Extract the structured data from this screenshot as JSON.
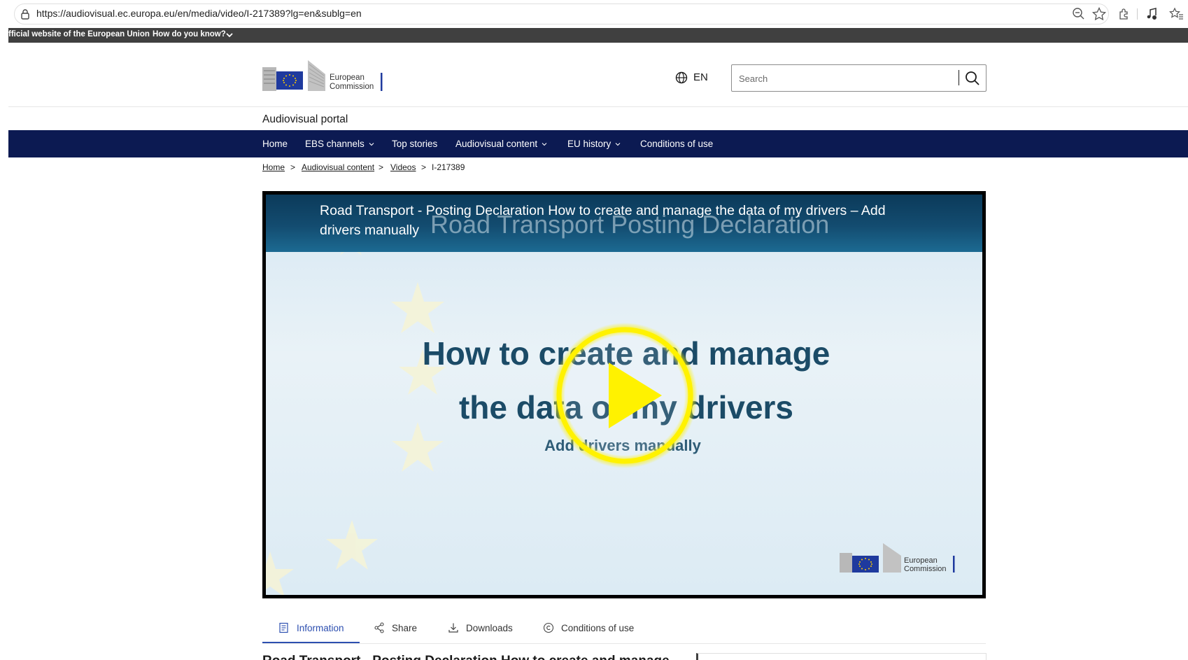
{
  "browser": {
    "url": "https://audiovisual.ec.europa.eu/en/media/video/I-217389?lg=en&sublg=en",
    "icons": [
      "lock-icon",
      "zoom-out-icon",
      "star-icon",
      "extensions-icon",
      "media-control-icon",
      "favorites-icon"
    ]
  },
  "gov_banner": {
    "text": "fficial website of the European Union",
    "link": "How do you know?"
  },
  "header": {
    "logo_line1": "European",
    "logo_line2": "Commission",
    "language": "EN",
    "search_placeholder": "Search",
    "portal_name": "Audiovisual portal"
  },
  "nav": {
    "items": [
      {
        "label": "Home",
        "dropdown": false
      },
      {
        "label": "EBS channels",
        "dropdown": true
      },
      {
        "label": "Top stories",
        "dropdown": false
      },
      {
        "label": "Audiovisual content",
        "dropdown": true
      },
      {
        "label": "EU history",
        "dropdown": true
      },
      {
        "label": "Conditions of use",
        "dropdown": false
      }
    ]
  },
  "breadcrumb": {
    "items": [
      "Home",
      "Audiovisual content",
      "Videos",
      "I-217389"
    ],
    "separator": ">"
  },
  "video": {
    "title": "Road Transport - Posting Declaration How to create and manage the data of my drivers – Add drivers manually",
    "slide_banner": "Road Transport Posting Declaration",
    "slide_line1": "How to create and manage",
    "slide_line2": "the data of my drivers",
    "slide_sub": "Add drivers manually",
    "logo_line1": "European",
    "logo_line2": "Commission",
    "play_color": "#fff200"
  },
  "tabs": {
    "items": [
      {
        "label": "Information",
        "icon": "information-icon",
        "active": true
      },
      {
        "label": "Share",
        "icon": "share-icon",
        "active": false
      },
      {
        "label": "Downloads",
        "icon": "download-icon",
        "active": false
      },
      {
        "label": "Conditions of use",
        "icon": "copyright-icon",
        "active": false
      }
    ]
  },
  "content": {
    "heading": "Road Transport - Posting Declaration How to create and manage"
  },
  "colors": {
    "nav_bg": "#0c1a52",
    "gov_banner_bg": "#404040",
    "active_tab": "#2d4fb0",
    "eu_blue": "#1f3a9e",
    "eu_yellow": "#ffcc00"
  }
}
